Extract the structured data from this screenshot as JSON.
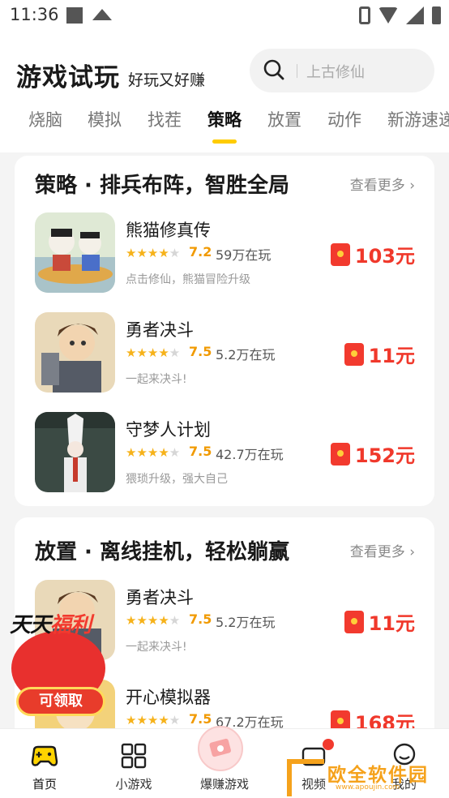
{
  "status_bar": {
    "time": "11:36"
  },
  "header": {
    "title": "游戏试玩",
    "subtitle": "好玩又好赚",
    "search_placeholder": "上古修仙"
  },
  "tabs": [
    {
      "label": "烧脑",
      "active": false
    },
    {
      "label": "模拟",
      "active": false
    },
    {
      "label": "找茬",
      "active": false
    },
    {
      "label": "策略",
      "active": true
    },
    {
      "label": "放置",
      "active": false
    },
    {
      "label": "动作",
      "active": false
    },
    {
      "label": "新游速递",
      "active": false
    }
  ],
  "sections": [
    {
      "title": "策略 · 排兵布阵，智胜全局",
      "more": "查看更多 ›",
      "games": [
        {
          "name": "熊猫修真传",
          "rating": "7.2",
          "players": "59万在玩",
          "desc": "点击修仙，熊猫冒险升级",
          "reward": "103元"
        },
        {
          "name": "勇者决斗",
          "rating": "7.5",
          "players": "5.2万在玩",
          "desc": "一起来决斗!",
          "reward": "11元"
        },
        {
          "name": "守梦人计划",
          "rating": "7.5",
          "players": "42.7万在玩",
          "desc": "猥琐升级，强大自己",
          "reward": "152元"
        }
      ]
    },
    {
      "title": "放置 · 离线挂机，轻松躺赢",
      "more": "查看更多 ›",
      "games": [
        {
          "name": "勇者决斗",
          "rating": "7.5",
          "players": "5.2万在玩",
          "desc": "一起来决斗!",
          "reward": "11元"
        },
        {
          "name": "开心模拟器",
          "rating": "7.5",
          "players": "67.2万在玩",
          "desc": "",
          "reward": "168元"
        }
      ]
    }
  ],
  "promo": {
    "title_a": "天天",
    "title_b": "福利",
    "button": "可领取"
  },
  "bottom_nav": [
    {
      "label": "首页",
      "icon": "gamepad-icon"
    },
    {
      "label": "小游戏",
      "icon": "grid-icon"
    },
    {
      "label": "爆赚游戏",
      "icon": "cash-icon"
    },
    {
      "label": "视频",
      "icon": "video-icon"
    },
    {
      "label": "我的",
      "icon": "profile-icon"
    }
  ],
  "watermark": {
    "text": "欧全软件园",
    "url": "www.apoujin.com"
  },
  "colors": {
    "accent": "#ffcc00",
    "reward": "#f0382b",
    "star": "#f6b21a"
  }
}
